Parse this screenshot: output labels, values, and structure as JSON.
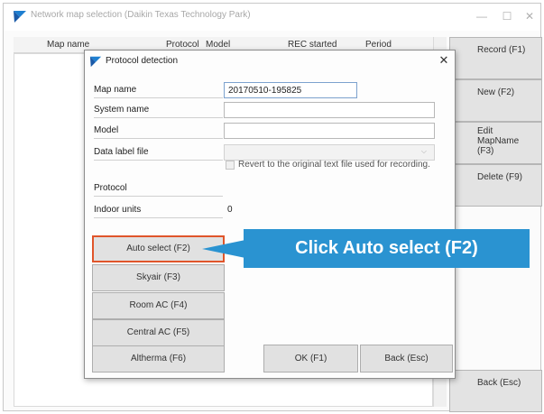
{
  "window": {
    "title": "Network map selection (Daikin Texas Technology Park)",
    "controls": {
      "minimize": "—",
      "maximize": "☐",
      "close": "✕"
    }
  },
  "table": {
    "columns": [
      "Map name",
      "Protocol",
      "Model",
      "REC started",
      "Period"
    ]
  },
  "side_buttons": {
    "record": "Record (F1)",
    "new": "New (F2)",
    "edit_line1": "Edit MapName",
    "edit_line2": "(F3)",
    "delete": "Delete (F9)",
    "back": "Back (Esc)"
  },
  "dialog": {
    "title": "Protocol detection",
    "close": "✕",
    "fields": {
      "map_name_label": "Map name",
      "map_name_value": "20170510-195825",
      "system_name_label": "System name",
      "system_name_value": "",
      "model_label": "Model",
      "model_value": "",
      "data_label_file_label": "Data label file",
      "data_label_file_value": ""
    },
    "revert_checkbox_label": "Revert to the original text file used for recording.",
    "protocol_label": "Protocol",
    "indoor_units_label": "Indoor units",
    "indoor_units_value": "0",
    "protocol_buttons": {
      "auto": "Auto select (F2)",
      "skyair": "Skyair (F3)",
      "room_ac": "Room AC (F4)",
      "central_ac": "Central AC (F5)",
      "altherma": "Altherma (F6)"
    },
    "ok": "OK (F1)",
    "back": "Back (Esc)"
  },
  "callout": {
    "text": "Click Auto select (F2)"
  },
  "colors": {
    "highlight": "#e0552a",
    "callout": "#2a93d1"
  }
}
